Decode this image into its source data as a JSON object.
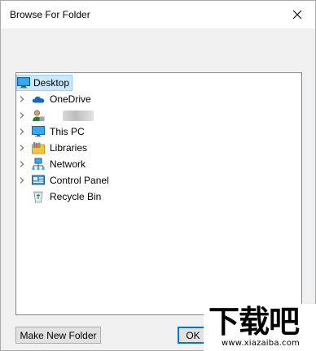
{
  "dialog": {
    "title": "Browse For Folder",
    "close_icon": "close-icon"
  },
  "tree": {
    "items": [
      {
        "label": "Desktop",
        "icon": "desktop-icon",
        "expandable": false,
        "selected": true
      },
      {
        "label": "OneDrive",
        "icon": "onedrive-cloud-icon",
        "expandable": true
      },
      {
        "label": "",
        "icon": "user-folder-icon",
        "expandable": true,
        "redacted": true
      },
      {
        "label": "This PC",
        "icon": "this-pc-icon",
        "expandable": true
      },
      {
        "label": "Libraries",
        "icon": "libraries-icon",
        "expandable": true
      },
      {
        "label": "Network",
        "icon": "network-icon",
        "expandable": true
      },
      {
        "label": "Control Panel",
        "icon": "control-panel-icon",
        "expandable": true
      },
      {
        "label": "Recycle Bin",
        "icon": "recycle-bin-icon",
        "expandable": false
      }
    ]
  },
  "buttons": {
    "make_new_folder": "Make New Folder",
    "ok": "OK"
  },
  "watermark": {
    "brand": "下载吧",
    "url": "www.xiazaiba.com"
  },
  "colors": {
    "selection_bg": "#cce8ff",
    "selection_border": "#99d1ff",
    "default_button_border": "#0078d7"
  }
}
